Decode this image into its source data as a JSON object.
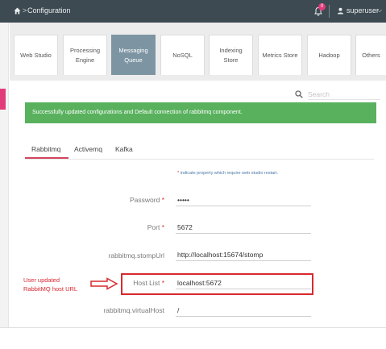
{
  "topbar": {
    "breadcrumb_separator": ">",
    "breadcrumb": "Configuration",
    "notification_count": "0",
    "username": "superuser",
    "caret": "⌵",
    "background_color": "#3e4a52"
  },
  "tiles": [
    {
      "label": "Web Studio",
      "active": false
    },
    {
      "label": "Processing Engine",
      "active": false
    },
    {
      "label": "Messaging Queue",
      "active": true
    },
    {
      "label": "NoSQL",
      "active": false
    },
    {
      "label": "Indexing Store",
      "active": false
    },
    {
      "label": "Metrics Store",
      "active": false
    },
    {
      "label": "Hadoop",
      "active": false
    },
    {
      "label": "Others",
      "active": false
    }
  ],
  "search": {
    "placeholder": "Search",
    "icon": "search-icon"
  },
  "alert": {
    "message": "Successfully updated configurations and Default connection of rabbitmq component.",
    "color": "#59b15e"
  },
  "tabs": [
    {
      "label": "Rabbitmq",
      "active": true
    },
    {
      "label": "Activemq",
      "active": false
    },
    {
      "label": "Kafka",
      "active": false
    }
  ],
  "required_note": {
    "star": "*",
    "text": "indicate property which require web studio restart."
  },
  "fields": [
    {
      "label": "Password",
      "required": true,
      "value": "•••••"
    },
    {
      "label": "Port",
      "required": true,
      "value": "5672"
    },
    {
      "label": "rabbitmq.stompUrl",
      "required": false,
      "value": "http://localhost:15674/stomp"
    },
    {
      "label": "Host List",
      "required": true,
      "value": "localhost:5672"
    },
    {
      "label": "rabbitmq.virtualHost",
      "required": false,
      "value": "/"
    }
  ],
  "annotation": {
    "line1": "User updated",
    "line2": "RabbitMQ host URL",
    "color": "#d8282f"
  },
  "colors": {
    "accent": "#d2455f",
    "active_tile": "#7d95a3",
    "left_marker": "#e23b7a"
  }
}
